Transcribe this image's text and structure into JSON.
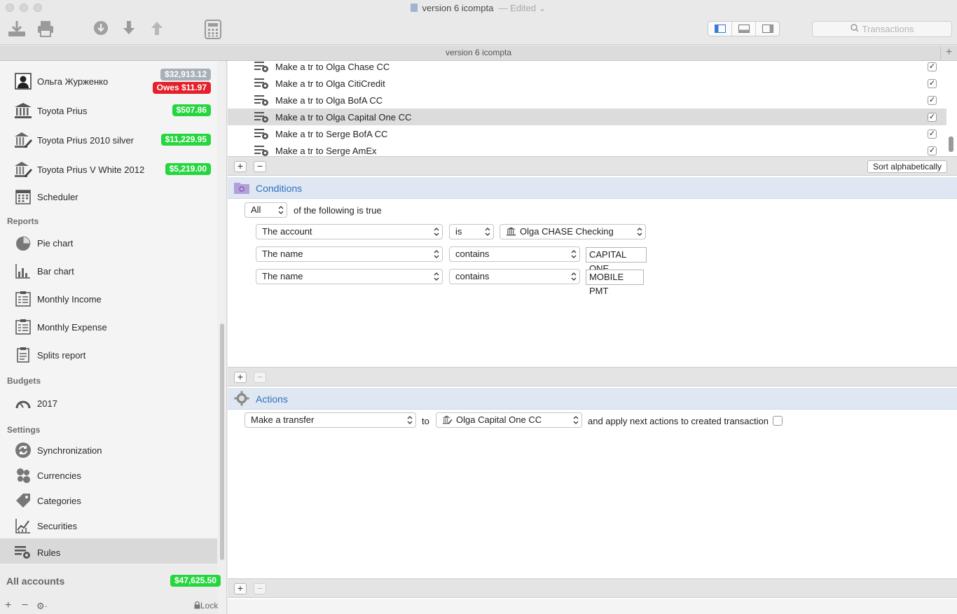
{
  "window": {
    "title": "version 6 icompta",
    "edited": "— Edited",
    "tab_title": "version 6 icompta",
    "search_placeholder": "Transactions"
  },
  "sidebar": {
    "accounts": [
      {
        "label": "Ольга Журженко",
        "badge": "$32,913.12",
        "badge_color": "#a8b0b8",
        "badge2": "Owes $11.97",
        "badge2_color": "#e5202b",
        "icon": "person-icon"
      },
      {
        "label": "Toyota Prius",
        "badge": "$507.86",
        "badge_color": "#26d63e",
        "icon": "bank-icon"
      },
      {
        "label": "Toyota Prius 2010 silver",
        "badge": "$11,229.95",
        "badge_color": "#26d63e",
        "icon": "bank-pen-icon"
      },
      {
        "label": "Toyota Prius V White 2012",
        "badge": "$5,219.00",
        "badge_color": "#26d63e",
        "icon": "bank-pen-icon"
      },
      {
        "label": "Scheduler",
        "icon": "calendar-icon"
      }
    ],
    "reports_header": "Reports",
    "reports": [
      {
        "label": "Pie chart",
        "icon": "pie-chart-icon"
      },
      {
        "label": "Bar chart",
        "icon": "bar-chart-icon"
      },
      {
        "label": "Monthly Income",
        "icon": "report-icon"
      },
      {
        "label": "Monthly Expense",
        "icon": "report-icon"
      },
      {
        "label": "Splits report",
        "icon": "clipboard-icon"
      }
    ],
    "budgets_header": "Budgets",
    "budgets": [
      {
        "label": "2017",
        "icon": "gauge-icon"
      }
    ],
    "settings_header": "Settings",
    "settings": [
      {
        "label": "Synchronization",
        "icon": "sync-icon"
      },
      {
        "label": "Currencies",
        "icon": "currencies-icon"
      },
      {
        "label": "Categories",
        "icon": "tag-icon"
      },
      {
        "label": "Securities",
        "icon": "stocks-icon"
      },
      {
        "label": "Rules",
        "icon": "rules-icon",
        "selected": true
      }
    ],
    "all_accounts_label": "All accounts",
    "all_accounts_total": "$47,625.50",
    "footer_add": "+",
    "footer_remove": "−",
    "footer_gear": "⚙·",
    "footer_lock": "Lock"
  },
  "rules": [
    {
      "name": "Make a tr to Olga Chase CC",
      "checked": true
    },
    {
      "name": "Make a tr to Olga CitiCredit",
      "checked": true
    },
    {
      "name": "Make a tr to Olga BofA CC",
      "checked": true
    },
    {
      "name": "Make a tr to Olga Capital One CC",
      "checked": true,
      "selected": true
    },
    {
      "name": "Make a tr to Serge BofA CC",
      "checked": true
    },
    {
      "name": "Make a tr to Serge AmEx",
      "checked": true
    }
  ],
  "rules_toolbar": {
    "add": "+",
    "remove": "−",
    "sort_label": "Sort alphabetically"
  },
  "conditions": {
    "title": "Conditions",
    "quantifier": "All",
    "quantifier_suffix": "of the following is true",
    "rows": [
      {
        "field": "The account",
        "op": "is",
        "value": "Olga CHASE Checking",
        "value_kind": "popup"
      },
      {
        "field": "The name",
        "op": "contains",
        "value": "CAPITAL ONE",
        "value_kind": "text"
      },
      {
        "field": "The name",
        "op": "contains",
        "value": "MOBILE PMT",
        "value_kind": "text"
      }
    ],
    "add": "+",
    "remove": "−"
  },
  "actions": {
    "title": "Actions",
    "action": "Make a transfer",
    "to_label": "to",
    "target": "Olga Capital One CC",
    "apply_label": "and apply next actions to created transaction",
    "apply_checked": false,
    "add": "+",
    "remove": "−"
  },
  "accent_color": "#2f6fbf"
}
